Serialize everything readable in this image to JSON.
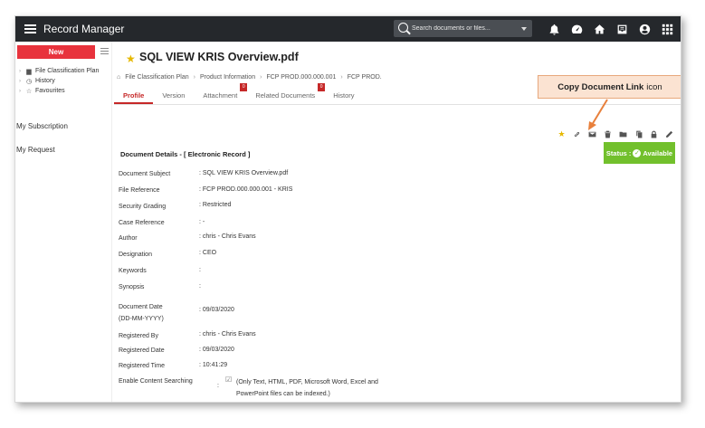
{
  "app": {
    "title": "Record Manager"
  },
  "search": {
    "placeholder": "Search documents or files..."
  },
  "sidebar": {
    "new_label": "New",
    "tree": [
      {
        "label": "File Classification Plan",
        "icon": "folder-icon"
      },
      {
        "label": "History",
        "icon": "clock-icon"
      },
      {
        "label": "Favourites",
        "icon": "star-outline-icon"
      }
    ],
    "links": [
      "My Subscription",
      "My Request"
    ]
  },
  "document": {
    "title": "SQL VIEW KRIS Overview.pdf",
    "breadcrumb": [
      "File Classification Plan",
      "Product Information",
      "FCP PROD.000.000.001",
      "FCP PROD."
    ]
  },
  "tabs": [
    {
      "label": "Profile",
      "active": true,
      "badge": ""
    },
    {
      "label": "Version",
      "active": false,
      "badge": ""
    },
    {
      "label": "Attachment",
      "active": false,
      "badge": "0"
    },
    {
      "label": "Related Documents",
      "active": false,
      "badge": "0"
    },
    {
      "label": "History",
      "active": false,
      "badge": ""
    }
  ],
  "callout": {
    "bold": "Copy Document Link",
    "rest": "icon"
  },
  "details": {
    "section_title": "Document Details - [ Electronic Record ]",
    "status_prefix": "Status :",
    "status_value": "Available",
    "status_color": "#72c02c",
    "fields": [
      {
        "label": "Document Subject",
        "value": ": SQL VIEW KRIS Overview.pdf"
      },
      {
        "label": "File Reference",
        "value": ": FCP PROD.000.000.001 - KRIS"
      },
      {
        "label": "Security Grading",
        "value": ": Restricted"
      },
      {
        "label": "Case Reference",
        "value": ": -"
      },
      {
        "label": "Author",
        "value": ": chris - Chris Evans"
      },
      {
        "label": "Designation",
        "value": ": CEO"
      },
      {
        "label": "Keywords",
        "value": ":"
      },
      {
        "label": "Synopsis",
        "value": ":"
      },
      {
        "label": "Document Date (DD-MM-YYYY)",
        "value": ": 09/03/2020"
      },
      {
        "label": "Registered By",
        "value": ": chris - Chris Evans"
      },
      {
        "label": "Registered Date",
        "value": ": 09/03/2020"
      },
      {
        "label": "Registered Time",
        "value": ": 10:41:29"
      }
    ],
    "content_search_label": "Enable Content Searching",
    "content_search_note": "(Only Text, HTML, PDF, Microsoft Word, Excel and PowerPoint files can be indexed.)"
  },
  "colors": {
    "accent": "#c62828",
    "new_button": "#e8333d",
    "topbar": "#25282c"
  }
}
